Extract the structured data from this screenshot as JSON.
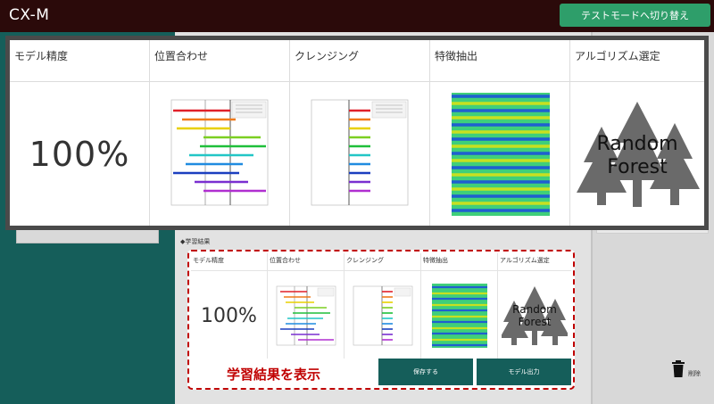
{
  "header": {
    "app_title": "CX-M",
    "test_mode_button": "テストモードへ切り替え"
  },
  "overlay": {
    "columns": [
      {
        "label": "モデル精度"
      },
      {
        "label": "位置合わせ"
      },
      {
        "label": "クレンジング"
      },
      {
        "label": "特徴抽出"
      },
      {
        "label": "アルゴリズム選定"
      }
    ],
    "accuracy": "100%",
    "algorithm_text": [
      "Random",
      "Forest"
    ]
  },
  "results": {
    "section_label": "◆学習結果",
    "columns": [
      {
        "label": "モデル精度"
      },
      {
        "label": "位置合わせ"
      },
      {
        "label": "クレンジング"
      },
      {
        "label": "特徴抽出"
      },
      {
        "label": "アルゴリズム選定"
      }
    ],
    "accuracy": "100%",
    "algorithm_text": [
      "Random",
      "Forest"
    ],
    "show_results_label": "学習結果を表示",
    "save_button": "保存する",
    "model_output_button": "モデル出力"
  },
  "sidebar": {
    "delete_label": "削除"
  },
  "colors": {
    "header_bg": "#2b0a0a",
    "brand_teal": "#155e5a",
    "test_mode_green": "#2e9e6a",
    "highlight_red": "#c00000"
  },
  "icons": {
    "delete": "trash-icon",
    "algorithm": "tree-icon"
  }
}
